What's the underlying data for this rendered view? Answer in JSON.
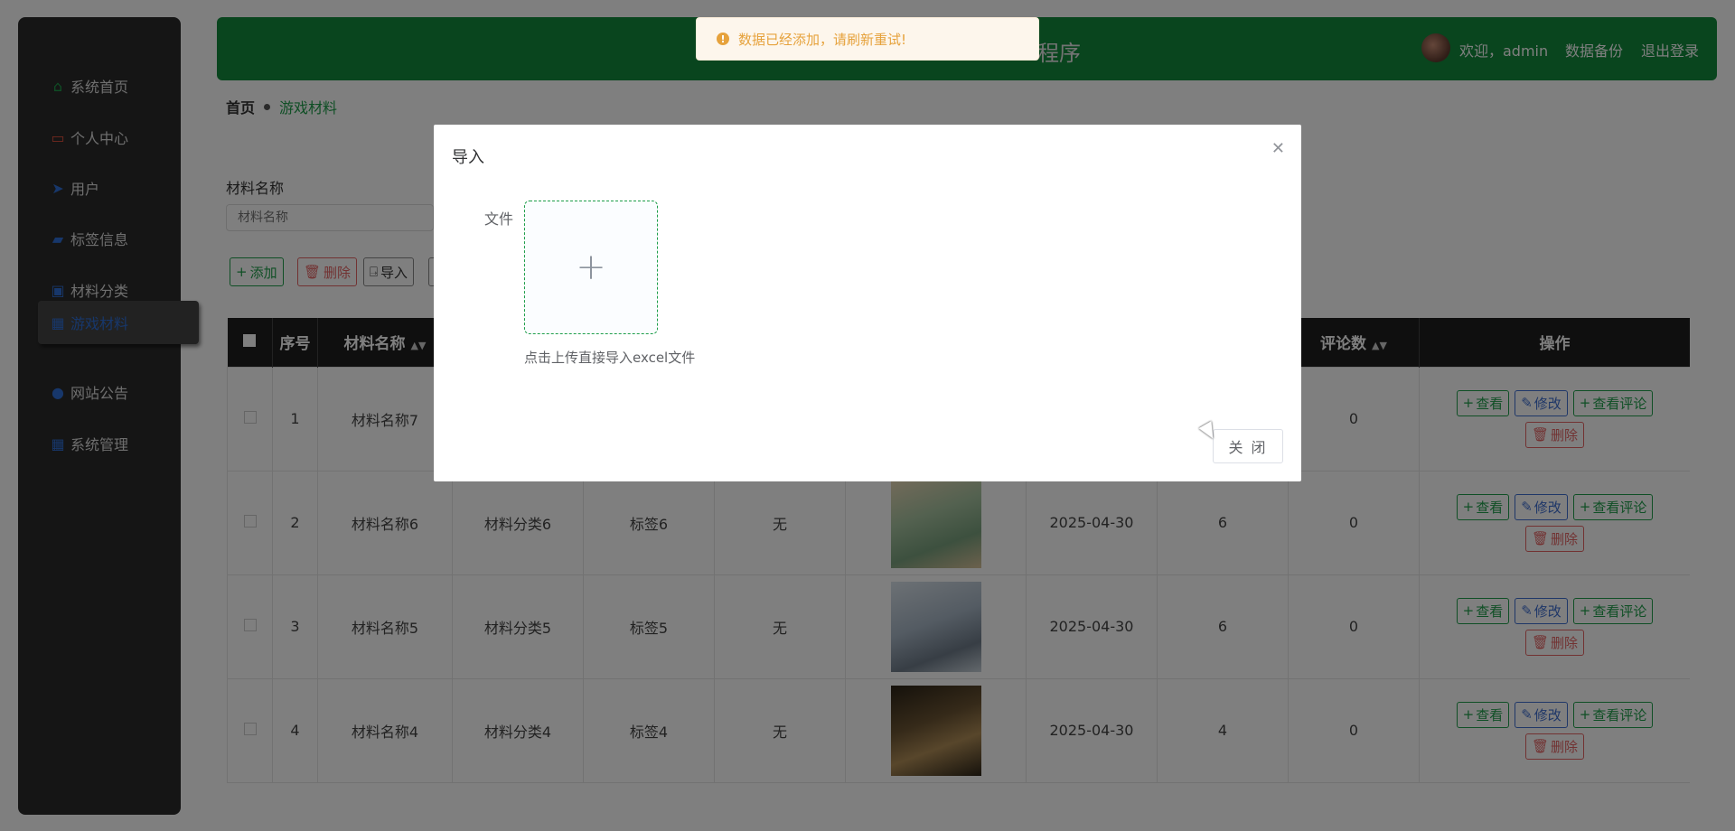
{
  "sidebar": {
    "items": [
      {
        "label": "系统首页",
        "icon": "home-icon"
      },
      {
        "label": "个人中心",
        "icon": "card-icon"
      },
      {
        "label": "用户",
        "icon": "send-icon"
      },
      {
        "label": "标签信息",
        "icon": "chart-icon"
      },
      {
        "label": "材料分类",
        "icon": "category-icon"
      },
      {
        "label": "游戏材料",
        "icon": "grid-icon"
      },
      {
        "label": "网站公告",
        "icon": "pin-icon"
      },
      {
        "label": "系统管理",
        "icon": "grid-icon"
      }
    ],
    "active_index": 5
  },
  "header": {
    "title_partial": "程序",
    "welcome": "欢迎，admin",
    "backup": "数据备份",
    "logout": "退出登录"
  },
  "breadcrumb": {
    "home": "首页",
    "current": "游戏材料"
  },
  "search": {
    "label": "材料名称",
    "placeholder": "材料名称"
  },
  "toolbar": {
    "add": "添加",
    "delete": "删除",
    "import": "导入"
  },
  "table": {
    "headers": {
      "index": "序号",
      "name": "材料名称",
      "comments": "评论数",
      "ops": "操作"
    },
    "rows": [
      {
        "index": "1",
        "name": "材料名称7",
        "category": "",
        "tag": "",
        "desc": "",
        "date": "",
        "count": "",
        "comments": "0"
      },
      {
        "index": "2",
        "name": "材料名称6",
        "category": "材料分类6",
        "tag": "标签6",
        "desc": "无",
        "date": "2025-04-30",
        "count": "6",
        "comments": "0"
      },
      {
        "index": "3",
        "name": "材料名称5",
        "category": "材料分类5",
        "tag": "标签5",
        "desc": "无",
        "date": "2025-04-30",
        "count": "6",
        "comments": "0"
      },
      {
        "index": "4",
        "name": "材料名称4",
        "category": "材料分类4",
        "tag": "标签4",
        "desc": "无",
        "date": "2025-04-30",
        "count": "4",
        "comments": "0"
      }
    ],
    "op_labels": {
      "view": "查看",
      "edit": "修改",
      "view_comments": "查看评论",
      "delete": "删除"
    }
  },
  "dialog": {
    "title": "导入",
    "file_label": "文件",
    "hint": "点击上传直接导入excel文件",
    "close_button": "关 闭"
  },
  "toast": {
    "message": "数据已经添加，请刷新重试!",
    "color": "#e6a23c"
  },
  "colors": {
    "accent": "#138a3c",
    "sidebar": "#2b2b2b"
  }
}
